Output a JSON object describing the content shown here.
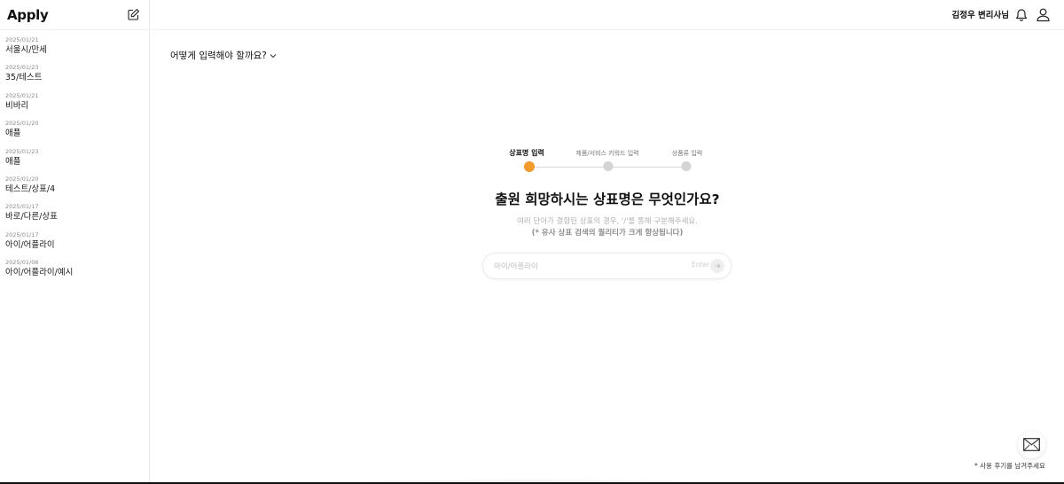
{
  "app": {
    "logo": "Apply"
  },
  "header": {
    "user_name": "김정우 변리사님"
  },
  "sidebar": {
    "items": [
      {
        "date": "2025/01/21",
        "title": "서울시/만세"
      },
      {
        "date": "2025/01/23",
        "title": "35/테스트"
      },
      {
        "date": "2025/01/21",
        "title": "비바리"
      },
      {
        "date": "2025/01/20",
        "title": "애플"
      },
      {
        "date": "2025/01/23",
        "title": "애플"
      },
      {
        "date": "2025/01/20",
        "title": "테스트/상표/4"
      },
      {
        "date": "2025/01/17",
        "title": "바로/다른/상표"
      },
      {
        "date": "2025/01/17",
        "title": "아이/어플라이"
      },
      {
        "date": "2025/01/06",
        "title": "아이/어플라이/예시"
      }
    ]
  },
  "main": {
    "guide_label": "어떻게 입력해야 할까요?",
    "steps": [
      {
        "label": "상표명 입력",
        "active": true
      },
      {
        "label": "제품/서비스 키워드 입력",
        "active": false
      },
      {
        "label": "상품류 입력",
        "active": false
      }
    ],
    "question": "출원 희망하시는 상표명은 무엇인가요?",
    "description": "여러 단어가 결합된 상표의 경우, '/'를 통해 구분해주세요.",
    "description_note": "(* 유사 상표 검색의 퀄리티가 크게 향상됩니다)",
    "input": {
      "value": "",
      "placeholder": "아이/어플라이",
      "enter_hint": "Enter"
    }
  },
  "footer": {
    "review_label": "* 사용 후기를 남겨주세요"
  },
  "colors": {
    "accent": "#f29a2c",
    "inactive_dot": "#d4d4d4"
  }
}
